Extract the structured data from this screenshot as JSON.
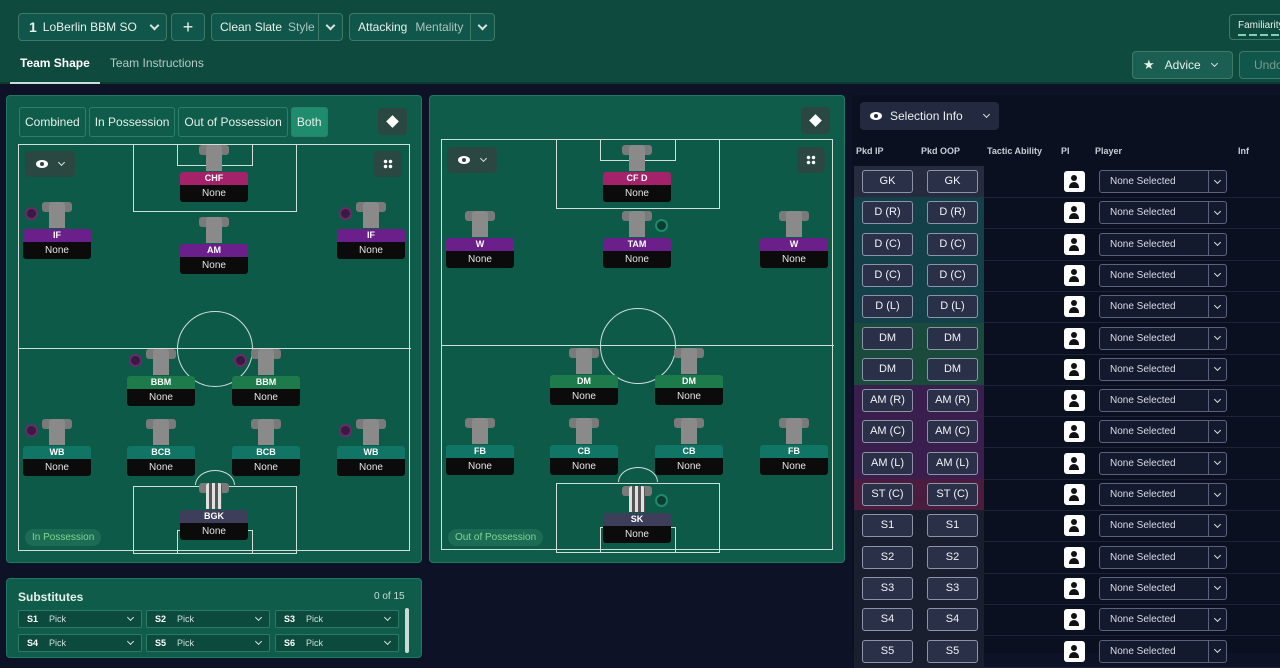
{
  "header": {
    "tactic_number": "1",
    "tactic_name": "LoBerlin BBM SO",
    "add_label": "+",
    "style_value": "Clean Slate",
    "style_label": "Style",
    "mentality_value": "Attacking",
    "mentality_label": "Mentality",
    "familiarity_label": "Familiarity",
    "advice_label": "Advice",
    "undo_label": "Undo"
  },
  "tabs": [
    {
      "label": "Team Shape",
      "active": true
    },
    {
      "label": "Team Instructions",
      "active": false
    }
  ],
  "view_modes": [
    "Combined",
    "In Possession",
    "Out of Possession",
    "Both"
  ],
  "selected_view": "Both",
  "in_possession": {
    "label": "In Possession",
    "players": [
      {
        "role": "CHF",
        "name": "None",
        "line": "st"
      },
      {
        "role": "IF",
        "name": "None",
        "line": "att"
      },
      {
        "role": "AM",
        "name": "None",
        "line": "att"
      },
      {
        "role": "IF",
        "name": "None",
        "line": "att"
      },
      {
        "role": "BBM",
        "name": "None",
        "line": "mid"
      },
      {
        "role": "BBM",
        "name": "None",
        "line": "mid"
      },
      {
        "role": "WB",
        "name": "None",
        "line": "def"
      },
      {
        "role": "BCB",
        "name": "None",
        "line": "def"
      },
      {
        "role": "BCB",
        "name": "None",
        "line": "def"
      },
      {
        "role": "WB",
        "name": "None",
        "line": "def"
      },
      {
        "role": "BGK",
        "name": "None",
        "line": "gk"
      }
    ]
  },
  "out_of_possession": {
    "label": "Out of Possession",
    "players": [
      {
        "role": "CF D",
        "name": "None",
        "line": "st"
      },
      {
        "role": "W",
        "name": "None",
        "line": "att"
      },
      {
        "role": "TAM",
        "name": "None",
        "line": "att"
      },
      {
        "role": "W",
        "name": "None",
        "line": "att"
      },
      {
        "role": "DM",
        "name": "None",
        "line": "mid"
      },
      {
        "role": "DM",
        "name": "None",
        "line": "mid"
      },
      {
        "role": "FB",
        "name": "None",
        "line": "def"
      },
      {
        "role": "CB",
        "name": "None",
        "line": "def"
      },
      {
        "role": "CB",
        "name": "None",
        "line": "def"
      },
      {
        "role": "FB",
        "name": "None",
        "line": "def"
      },
      {
        "role": "SK",
        "name": "None",
        "line": "gk"
      }
    ]
  },
  "substitutes": {
    "title": "Substitutes",
    "count": "0 of 15",
    "rows": [
      {
        "slot": "S1",
        "value": "Pick"
      },
      {
        "slot": "S2",
        "value": "Pick"
      },
      {
        "slot": "S3",
        "value": "Pick"
      },
      {
        "slot": "S4",
        "value": "Pick"
      },
      {
        "slot": "S5",
        "value": "Pick"
      },
      {
        "slot": "S6",
        "value": "Pick"
      }
    ]
  },
  "selection": {
    "button_label": "Selection Info",
    "headers": {
      "pkd_ip": "Pkd IP",
      "pkd_oop": "Pkd OOP",
      "tactic_ability": "Tactic Ability",
      "pi": "PI",
      "player": "Player",
      "inf": "Inf"
    },
    "rows": [
      {
        "ip": "GK",
        "oop": "GK",
        "player": "None Selected",
        "group": "gk"
      },
      {
        "ip": "D (R)",
        "oop": "D (R)",
        "player": "None Selected",
        "group": "def"
      },
      {
        "ip": "D (C)",
        "oop": "D (C)",
        "player": "None Selected",
        "group": "def"
      },
      {
        "ip": "D (C)",
        "oop": "D (C)",
        "player": "None Selected",
        "group": "def"
      },
      {
        "ip": "D (L)",
        "oop": "D (L)",
        "player": "None Selected",
        "group": "def"
      },
      {
        "ip": "DM",
        "oop": "DM",
        "player": "None Selected",
        "group": "mid"
      },
      {
        "ip": "DM",
        "oop": "DM",
        "player": "None Selected",
        "group": "mid"
      },
      {
        "ip": "AM (R)",
        "oop": "AM (R)",
        "player": "None Selected",
        "group": "att"
      },
      {
        "ip": "AM (C)",
        "oop": "AM (C)",
        "player": "None Selected",
        "group": "att"
      },
      {
        "ip": "AM (L)",
        "oop": "AM (L)",
        "player": "None Selected",
        "group": "att"
      },
      {
        "ip": "ST (C)",
        "oop": "ST (C)",
        "player": "None Selected",
        "group": "st"
      },
      {
        "ip": "S1",
        "oop": "S1",
        "player": "None Selected",
        "group": "sub"
      },
      {
        "ip": "S2",
        "oop": "S2",
        "player": "None Selected",
        "group": "sub"
      },
      {
        "ip": "S3",
        "oop": "S3",
        "player": "None Selected",
        "group": "sub"
      },
      {
        "ip": "S4",
        "oop": "S4",
        "player": "None Selected",
        "group": "sub"
      },
      {
        "ip": "S5",
        "oop": "S5",
        "player": "None Selected",
        "group": "sub"
      }
    ]
  },
  "colors": {
    "attack_role": "#6a1f8a",
    "midfield_role": "#1d7a4a",
    "defence_role": "#107565",
    "striker_role": "#a3226a",
    "pitch": "#0e5a48"
  }
}
